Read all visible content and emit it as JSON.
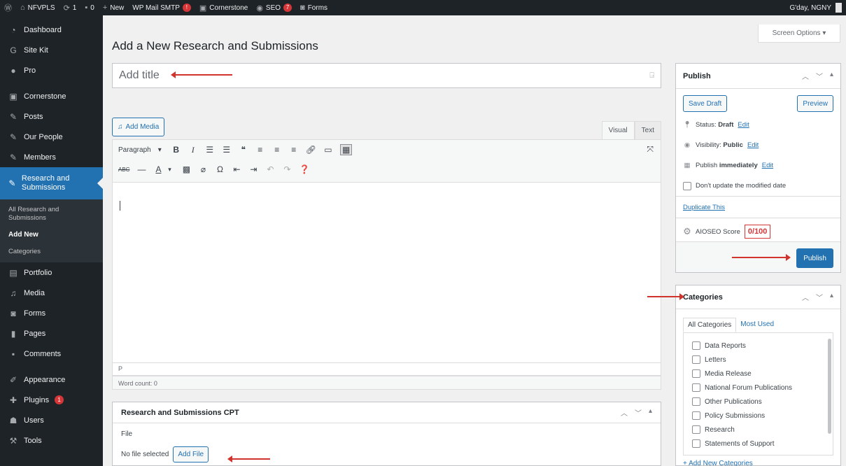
{
  "adminbar": {
    "items": [
      {
        "icon": "wp-logo-icon",
        "label": ""
      },
      {
        "icon": "home-icon",
        "label": "NFVPLS"
      },
      {
        "icon": "updates-icon",
        "label": "1"
      },
      {
        "icon": "comment-icon",
        "label": "0"
      },
      {
        "icon": "plus-icon",
        "label": "New"
      },
      {
        "icon": "",
        "label": "WP Mail SMTP",
        "badge": "!"
      },
      {
        "icon": "cornerstone-icon",
        "label": "Cornerstone"
      },
      {
        "icon": "seo-icon",
        "label": "SEO",
        "badge": "7"
      },
      {
        "icon": "forms-icon",
        "label": "Forms"
      }
    ],
    "greeting": "G'day, NGNY"
  },
  "sidebar": {
    "items": [
      {
        "icon": "dashboard-icon",
        "label": "Dashboard"
      },
      {
        "icon": "sitekit-icon",
        "label": "Site Kit"
      },
      {
        "icon": "pro-icon",
        "label": "Pro"
      },
      {
        "icon": "cornerstone-icon",
        "label": "Cornerstone"
      },
      {
        "icon": "pin-icon",
        "label": "Posts"
      },
      {
        "icon": "pin-icon",
        "label": "Our People"
      },
      {
        "icon": "pin-icon",
        "label": "Members"
      },
      {
        "icon": "pin-icon",
        "label": "Research and Submissions"
      },
      {
        "icon": "portfolio-icon",
        "label": "Portfolio"
      },
      {
        "icon": "media-icon",
        "label": "Media"
      },
      {
        "icon": "forms-icon",
        "label": "Forms"
      },
      {
        "icon": "pages-icon",
        "label": "Pages"
      },
      {
        "icon": "comments-icon",
        "label": "Comments"
      },
      {
        "icon": "appearance-icon",
        "label": "Appearance"
      },
      {
        "icon": "plugins-icon",
        "label": "Plugins",
        "badge": "1"
      },
      {
        "icon": "users-icon",
        "label": "Users"
      },
      {
        "icon": "tools-icon",
        "label": "Tools"
      }
    ],
    "submenu": [
      "All Research and Submissions",
      "Add New",
      "Categories"
    ]
  },
  "screen_options": "Screen Options ▾",
  "page_title": "Add a New Research and Submissions",
  "title_input": {
    "placeholder": "Add title"
  },
  "editor": {
    "add_media": "Add Media",
    "tabs": [
      "Visual",
      "Text"
    ],
    "format_select": "Paragraph",
    "path": "P",
    "word_count": "Word count: 0"
  },
  "cpt_box": {
    "title": "Research and Submissions CPT",
    "field_label": "File",
    "no_file": "No file selected",
    "add_file": "Add File"
  },
  "publish": {
    "title": "Publish",
    "save_draft": "Save Draft",
    "preview": "Preview",
    "status_label": "Status: ",
    "status_value": "Draft",
    "visibility_label": "Visibility: ",
    "visibility_value": "Public",
    "publish_label": "Publish ",
    "publish_value": "immediately",
    "edit": "Edit",
    "dont_update": "Don't update the modified date",
    "duplicate": "Duplicate This",
    "aioseo_label": "AIOSEO Score",
    "aioseo_score": "0/100",
    "publish_button": "Publish"
  },
  "categories": {
    "title": "Categories",
    "tabs": [
      "All Categories",
      "Most Used"
    ],
    "items": [
      "Data Reports",
      "Letters",
      "Media Release",
      "National Forum Publications",
      "Other Publications",
      "Policy Submissions",
      "Research",
      "Statements of Support"
    ],
    "add_new": "+ Add New Categories"
  },
  "colors": {
    "accent": "#2271b1",
    "adminbar": "#1d2327",
    "annotation": "#d0342c"
  }
}
